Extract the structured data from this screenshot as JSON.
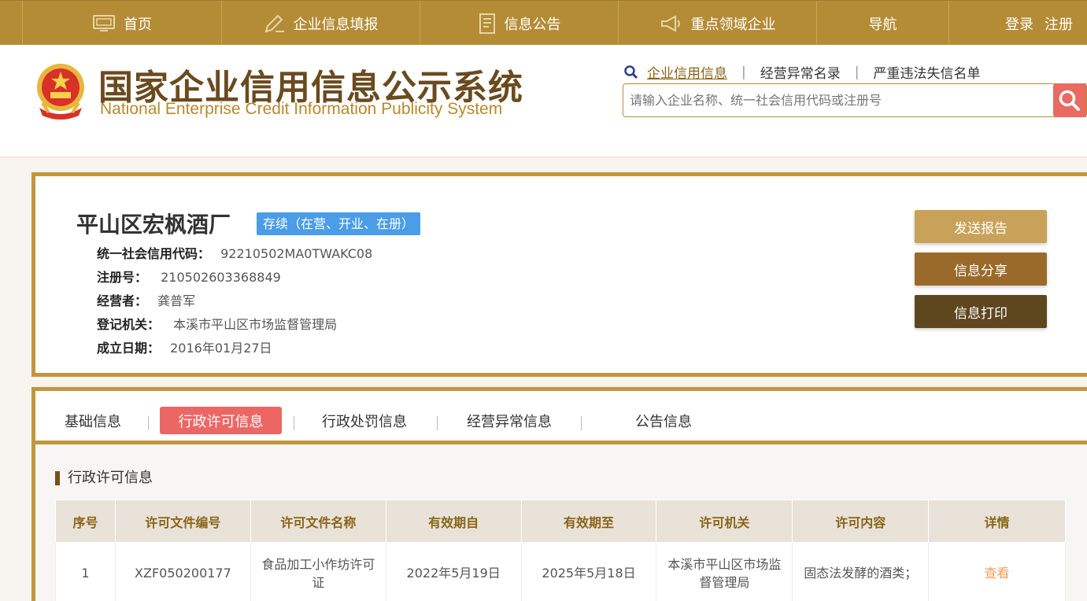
{
  "nav": {
    "home": "首页",
    "report": "企业信息填报",
    "notice": "信息公告",
    "key_enterprise": "重点领域企业",
    "navigation": "导航",
    "login": "登录",
    "register": "注册"
  },
  "header": {
    "title_cn": "国家企业信用信息公示系统",
    "title_en": "National Enterprise Credit Information Publicity System",
    "search_links": [
      "企业信用信息",
      "经营异常名录",
      "严重违法失信名单"
    ],
    "search_placeholder": "请输入企业名称、统一社会信用代码或注册号"
  },
  "company": {
    "name": "平山区宏枫酒厂",
    "status": "存续（在营、开业、在册）",
    "fields": [
      {
        "label": "统一社会信用代码：",
        "value": "92210502MA0TWAKC08"
      },
      {
        "label": "注册号：",
        "value": "210502603368849"
      },
      {
        "label": "经营者：",
        "value": "龚普军"
      },
      {
        "label": "登记机关：",
        "value": "本溪市平山区市场监督管理局"
      },
      {
        "label": "成立日期：",
        "value": "2016年01月27日"
      }
    ],
    "actions": [
      "发送报告",
      "信息分享",
      "信息打印"
    ]
  },
  "tabs": [
    "基础信息",
    "行政许可信息",
    "行政处罚信息",
    "经营异常信息",
    "公告信息"
  ],
  "active_tab": "行政许可信息",
  "section": {
    "title": "行政许可信息",
    "columns": [
      "序号",
      "许可文件编号",
      "许可文件名称",
      "有效期自",
      "有效期至",
      "许可机关",
      "许可内容",
      "详情"
    ],
    "rows": [
      [
        "1",
        "XZF050200177",
        "食品加工小作坊许可证",
        "2022年5月19日",
        "2025年5月18日",
        "本溪市平山区市场监督管理局",
        "固态法发酵的酒类；",
        "查看"
      ]
    ]
  },
  "colors": {
    "nav_bg": "#b48c36",
    "card_border": "#c2973c",
    "status_badge": "#4a9de6",
    "active_tab": "#ec6764",
    "search_button": "#e86a61",
    "btn_send": "#c9a25a",
    "btn_share": "#9a6a2a",
    "btn_print": "#5e461f"
  }
}
